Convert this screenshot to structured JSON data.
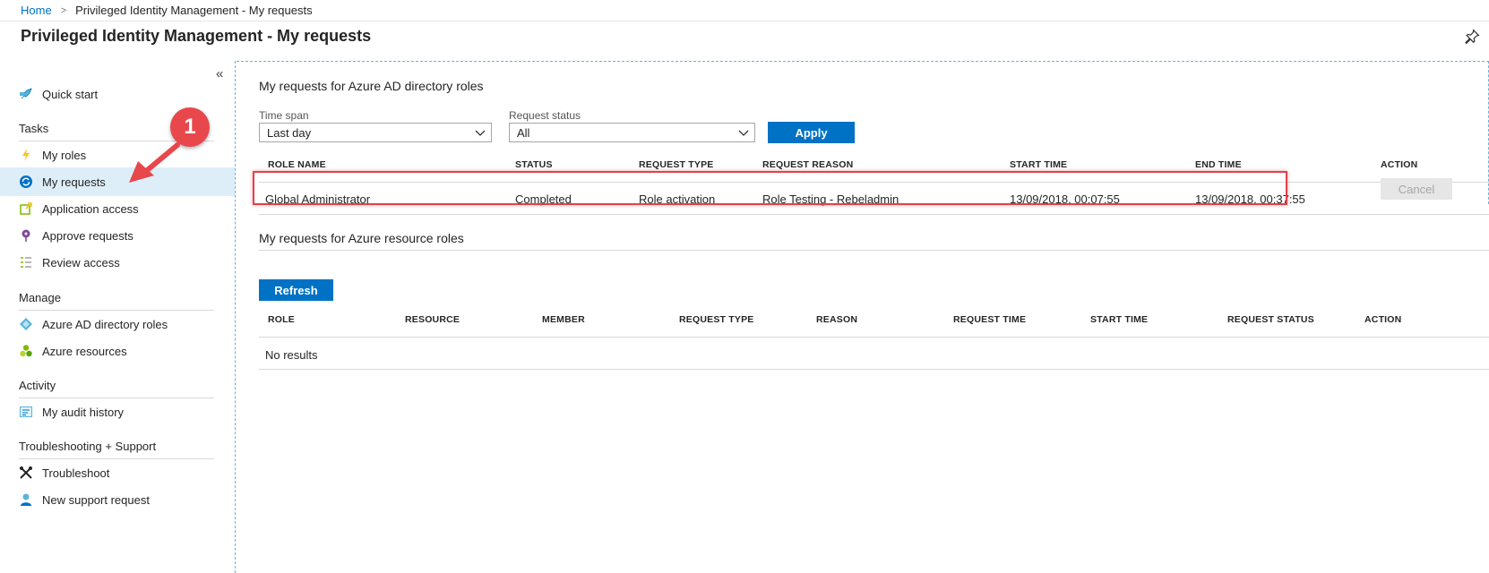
{
  "breadcrumb": {
    "home": "Home",
    "separator": ">",
    "current": "Privileged Identity Management - My requests"
  },
  "page": {
    "title": "Privileged Identity Management - My requests"
  },
  "sidebar": {
    "collapse": "«",
    "quick_start": "Quick start",
    "sections": {
      "tasks": "Tasks",
      "manage": "Manage",
      "activity": "Activity",
      "support": "Troubleshooting + Support"
    },
    "items": {
      "my_roles": "My roles",
      "my_requests": "My requests",
      "application_access": "Application access",
      "approve_requests": "Approve requests",
      "review_access": "Review access",
      "azure_ad_roles": "Azure AD directory roles",
      "azure_resources": "Azure resources",
      "audit_history": "My audit history",
      "troubleshoot": "Troubleshoot",
      "new_support": "New support request"
    },
    "active_item": "my_requests"
  },
  "annotation": {
    "badge": "1"
  },
  "directory_roles": {
    "title": "My requests for Azure AD directory roles",
    "time_span_label": "Time span",
    "time_span_value": "Last day",
    "request_status_label": "Request status",
    "request_status_value": "All",
    "apply": "Apply",
    "columns": [
      "ROLE NAME",
      "STATUS",
      "REQUEST TYPE",
      "REQUEST REASON",
      "START TIME",
      "END TIME",
      "ACTION"
    ],
    "rows": [
      {
        "role_name": "Global Administrator",
        "status": "Completed",
        "request_type": "Role activation",
        "request_reason": "Role Testing - Rebeladmin",
        "start_time": "13/09/2018, 00:07:55",
        "end_time": "13/09/2018, 00:37:55",
        "action": "Cancel"
      }
    ]
  },
  "resource_roles": {
    "title": "My requests for Azure resource roles",
    "refresh": "Refresh",
    "columns": [
      "ROLE",
      "RESOURCE",
      "MEMBER",
      "REQUEST TYPE",
      "REASON",
      "REQUEST TIME",
      "START TIME",
      "REQUEST STATUS",
      "ACTION"
    ],
    "empty": "No results"
  },
  "colors": {
    "accent": "#0072c6",
    "highlight": "#e0434b",
    "active_nav": "#ddeef9"
  }
}
